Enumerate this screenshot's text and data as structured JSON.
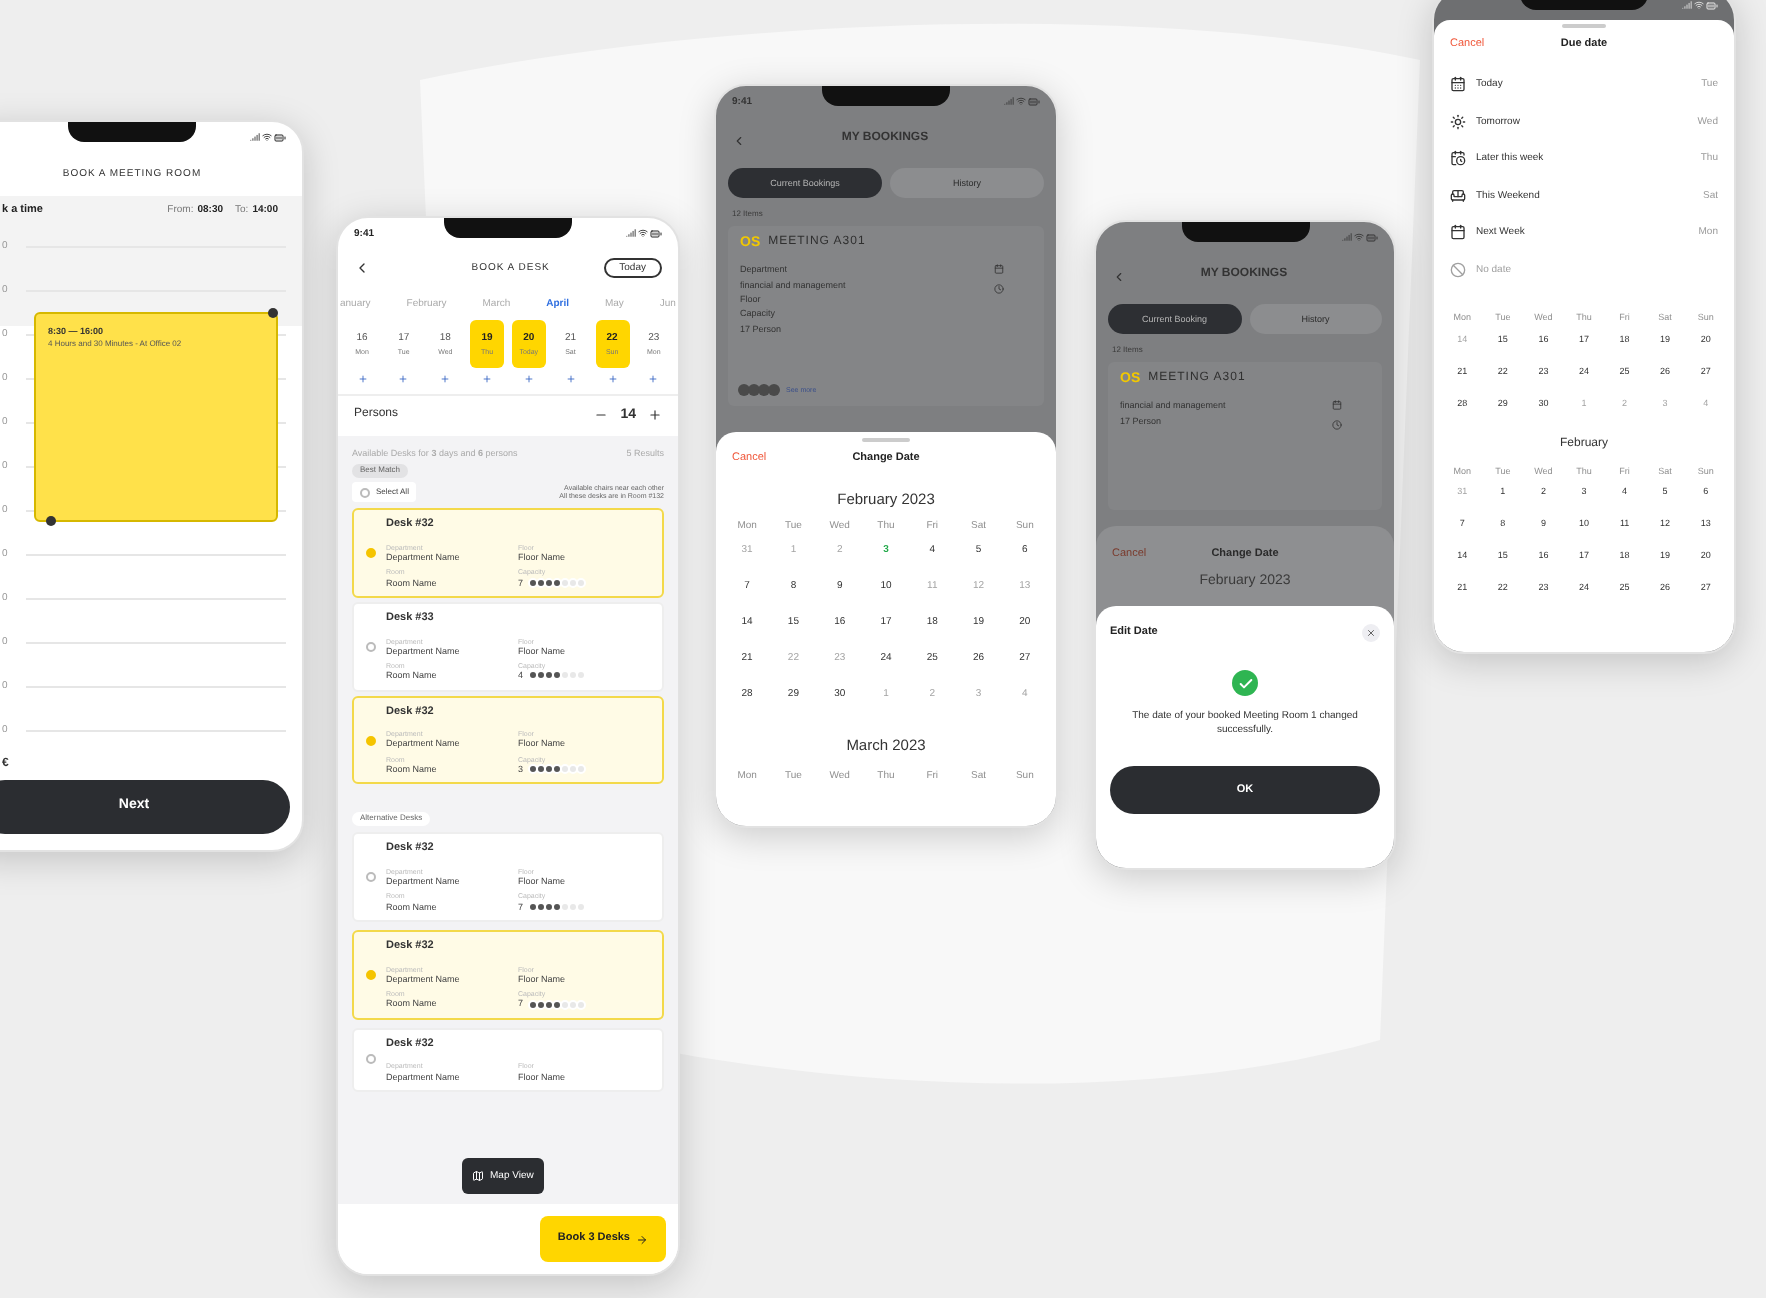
{
  "meeting_room": {
    "title": "BOOK A MEETING ROOM",
    "section": "k a time",
    "from_label": "From:",
    "from": "08:30",
    "to_label": "To:",
    "to": "14:00",
    "hours": [
      "0",
      "0",
      "0",
      "0",
      "0",
      "0",
      "0",
      "0",
      "0",
      "0",
      "0",
      "0"
    ],
    "event": {
      "time": "8:30 — 16:00",
      "detail": "4 Hours and 30 Minutes - At Office 02"
    },
    "footnote": "€",
    "button": "Next"
  },
  "book_desk": {
    "time": "9:41",
    "title": "BOOK A DESK",
    "today_button": "Today",
    "months": [
      {
        "label": "anuary",
        "selected": false
      },
      {
        "label": "February",
        "selected": false
      },
      {
        "label": "March",
        "selected": false
      },
      {
        "label": "April",
        "selected": true
      },
      {
        "label": "May",
        "selected": false
      },
      {
        "label": "Jun",
        "selected": false
      }
    ],
    "days": [
      {
        "date": "16",
        "weekday": "Mon",
        "selected": false
      },
      {
        "date": "17",
        "weekday": "Tue",
        "selected": false
      },
      {
        "date": "18",
        "weekday": "Wed",
        "selected": false
      },
      {
        "date": "19",
        "weekday": "Thu",
        "selected": true
      },
      {
        "date": "20",
        "weekday": "Today",
        "selected": true
      },
      {
        "date": "21",
        "weekday": "Sat",
        "selected": false
      },
      {
        "date": "22",
        "weekday": "Sun",
        "selected": true
      },
      {
        "date": "23",
        "weekday": "Mon",
        "selected": false
      }
    ],
    "persons_label": "Persons",
    "persons": "14",
    "summary": "Available Desks for **3** days and **6** persons",
    "results": "5 Results",
    "best_match": "Best Match",
    "select_all": "Select All",
    "select_all_checked": false,
    "notes": [
      "Available chairs near each other",
      "All these desks are in Room #132"
    ],
    "desks": [
      {
        "name": "Desk #32",
        "selected": true,
        "department_label": "Department",
        "department": "Department Name",
        "floor_label": "Floor",
        "floor": "Floor Name",
        "room_label": "Room",
        "room": "Room Name",
        "capacity_label": "Capacity",
        "capacity": "7"
      },
      {
        "name": "Desk #33",
        "selected": false,
        "department_label": "Department",
        "department": "Department Name",
        "floor_label": "Floor",
        "floor": "Floor Name",
        "room_label": "Room",
        "room": "Room Name",
        "capacity_label": "Capacity",
        "capacity": "4"
      },
      {
        "name": "Desk #32",
        "selected": true,
        "department_label": "Department",
        "department": "Department Name",
        "floor_label": "Floor",
        "floor": "Floor Name",
        "room_label": "Room",
        "room": "Room Name",
        "capacity_label": "Capacity",
        "capacity": "3"
      }
    ],
    "alternative_label": "Alternative Desks",
    "alternative_desks": [
      {
        "name": "Desk #32",
        "selected": false,
        "department_label": "Department",
        "department": "Department Name",
        "floor_label": "Floor",
        "floor": "Floor Name",
        "room_label": "Room",
        "room": "Room Name",
        "capacity_label": "Capacity",
        "capacity": "7"
      },
      {
        "name": "Desk #32",
        "selected": true,
        "department_label": "Department",
        "department": "Department Name",
        "floor_label": "Floor",
        "floor": "Floor Name",
        "room_label": "Room",
        "room": "Room Name",
        "capacity_label": "Capacity",
        "capacity": "7"
      },
      {
        "name": "Desk #32",
        "selected": false,
        "department_label": "Department",
        "department": "Department Name",
        "floor_label": "Floor",
        "floor": "Floor Name"
      }
    ],
    "map_view": "Map View",
    "book_button": "Book 3 Desks"
  },
  "change_date": {
    "background": {
      "time": "9:41",
      "title": "MY BOOKINGS",
      "tabs": [
        {
          "label": "Current Bookings",
          "selected": true
        },
        {
          "label": "History",
          "selected": false
        }
      ],
      "count": "12 Items",
      "logo": "OS",
      "room": "MEETING A301",
      "fields": [
        "Department",
        "financial and management",
        "Floor",
        "Capacity",
        "17 Person"
      ],
      "link": "See more"
    },
    "cancel": "Cancel",
    "title": "Change Date",
    "month": "February 2023",
    "weekdays": [
      "Mon",
      "Tue",
      "Wed",
      "Thu",
      "Fri",
      "Sat",
      "Sun"
    ],
    "weeks": [
      [
        {
          "d": "31",
          "kind": "muted"
        },
        {
          "d": "1",
          "kind": "muted"
        },
        {
          "d": "2",
          "kind": "muted"
        },
        {
          "d": "3",
          "kind": "today"
        },
        {
          "d": "4",
          "kind": "normal"
        },
        {
          "d": "5",
          "kind": "normal"
        },
        {
          "d": "6",
          "kind": "normal"
        }
      ],
      [
        {
          "d": "7",
          "kind": "normal"
        },
        {
          "d": "8",
          "kind": "normal"
        },
        {
          "d": "9",
          "kind": "normal"
        },
        {
          "d": "10",
          "kind": "normal"
        },
        {
          "d": "11",
          "kind": "muted"
        },
        {
          "d": "12",
          "kind": "muted"
        },
        {
          "d": "13",
          "kind": "muted"
        }
      ],
      [
        {
          "d": "14",
          "kind": "normal"
        },
        {
          "d": "15",
          "kind": "normal"
        },
        {
          "d": "16",
          "kind": "normal"
        },
        {
          "d": "17",
          "kind": "normal"
        },
        {
          "d": "18",
          "kind": "normal"
        },
        {
          "d": "19",
          "kind": "normal"
        },
        {
          "d": "20",
          "kind": "normal"
        }
      ],
      [
        {
          "d": "21",
          "kind": "normal"
        },
        {
          "d": "22",
          "kind": "muted"
        },
        {
          "d": "23",
          "kind": "muted"
        },
        {
          "d": "24",
          "kind": "normal"
        },
        {
          "d": "25",
          "kind": "normal"
        },
        {
          "d": "26",
          "kind": "normal"
        },
        {
          "d": "27",
          "kind": "normal"
        }
      ],
      [
        {
          "d": "28",
          "kind": "normal"
        },
        {
          "d": "29",
          "kind": "normal"
        },
        {
          "d": "30",
          "kind": "normal"
        },
        {
          "d": "1",
          "kind": "muted"
        },
        {
          "d": "2",
          "kind": "muted"
        },
        {
          "d": "3",
          "kind": "muted"
        },
        {
          "d": "4",
          "kind": "muted"
        }
      ]
    ],
    "next_month": "March 2023",
    "next_weekdays": [
      "Mon",
      "Tue",
      "Wed",
      "Thu",
      "Fri",
      "Sat",
      "Sun"
    ]
  },
  "edit_date": {
    "background": {
      "title": "MY BOOKINGS",
      "tabs": [
        {
          "label": "Current Booking",
          "selected": true
        },
        {
          "label": "History",
          "selected": false
        }
      ],
      "count": "12 Items",
      "logo": "OS",
      "room": "MEETING A301",
      "fields": [
        "financial and management",
        "17 Person"
      ]
    },
    "sheet_cancel": "Cancel",
    "sheet_title": "Change Date",
    "sheet_month": "February 2023",
    "dialog_title": "Edit Date",
    "message": "The date of your booked Meeting Room 1 changed successfully.",
    "button": "OK"
  },
  "due_date": {
    "cancel": "Cancel",
    "title": "Due date",
    "options": [
      {
        "label": "Today",
        "day": "Tue",
        "disabled": false
      },
      {
        "label": "Tomorrow",
        "day": "Wed",
        "disabled": false
      },
      {
        "label": "Later this week",
        "day": "Thu",
        "disabled": false
      },
      {
        "label": "This Weekend",
        "day": "Sat",
        "disabled": false
      },
      {
        "label": "Next Week",
        "day": "Mon",
        "disabled": false
      },
      {
        "label": "No date",
        "disabled": true
      }
    ],
    "weekdays": [
      "Mon",
      "Tue",
      "Wed",
      "Thu",
      "Fri",
      "Sat",
      "Sun"
    ],
    "weeks": [
      [
        {
          "d": "14",
          "kind": "muted"
        },
        {
          "d": "15",
          "kind": "normal"
        },
        {
          "d": "16",
          "kind": "normal"
        },
        {
          "d": "17",
          "kind": "normal"
        },
        {
          "d": "18",
          "kind": "normal"
        },
        {
          "d": "19",
          "kind": "normal"
        },
        {
          "d": "20",
          "kind": "normal"
        }
      ],
      [
        {
          "d": "21",
          "kind": "normal"
        },
        {
          "d": "22",
          "kind": "normal"
        },
        {
          "d": "23",
          "kind": "normal"
        },
        {
          "d": "24",
          "kind": "normal"
        },
        {
          "d": "25",
          "kind": "normal"
        },
        {
          "d": "26",
          "kind": "normal"
        },
        {
          "d": "27",
          "kind": "normal"
        }
      ],
      [
        {
          "d": "28",
          "kind": "normal"
        },
        {
          "d": "29",
          "kind": "normal"
        },
        {
          "d": "30",
          "kind": "normal"
        },
        {
          "d": "1",
          "kind": "muted"
        },
        {
          "d": "2",
          "kind": "muted"
        },
        {
          "d": "3",
          "kind": "muted"
        },
        {
          "d": "4",
          "kind": "muted"
        }
      ]
    ],
    "next_month": "February",
    "next_weekdays": [
      "Mon",
      "Tue",
      "Wed",
      "Thu",
      "Fri",
      "Sat",
      "Sun"
    ],
    "next_weeks": [
      [
        {
          "d": "31",
          "kind": "muted"
        },
        {
          "d": "1",
          "kind": "normal"
        },
        {
          "d": "2",
          "kind": "normal"
        },
        {
          "d": "3",
          "kind": "normal"
        },
        {
          "d": "4",
          "kind": "normal"
        },
        {
          "d": "5",
          "kind": "normal"
        },
        {
          "d": "6",
          "kind": "normal"
        }
      ],
      [
        {
          "d": "7",
          "kind": "normal"
        },
        {
          "d": "8",
          "kind": "normal"
        },
        {
          "d": "9",
          "kind": "normal"
        },
        {
          "d": "10",
          "kind": "normal"
        },
        {
          "d": "11",
          "kind": "normal"
        },
        {
          "d": "12",
          "kind": "normal"
        },
        {
          "d": "13",
          "kind": "normal"
        }
      ],
      [
        {
          "d": "14",
          "kind": "normal"
        },
        {
          "d": "15",
          "kind": "normal"
        },
        {
          "d": "16",
          "kind": "normal"
        },
        {
          "d": "17",
          "kind": "normal"
        },
        {
          "d": "18",
          "kind": "normal"
        },
        {
          "d": "19",
          "kind": "normal"
        },
        {
          "d": "20",
          "kind": "normal"
        }
      ],
      [
        {
          "d": "21",
          "kind": "normal"
        },
        {
          "d": "22",
          "kind": "normal"
        },
        {
          "d": "23",
          "kind": "normal"
        },
        {
          "d": "24",
          "kind": "normal"
        },
        {
          "d": "25",
          "kind": "normal"
        },
        {
          "d": "26",
          "kind": "normal"
        },
        {
          "d": "27",
          "kind": "normal"
        }
      ]
    ]
  }
}
